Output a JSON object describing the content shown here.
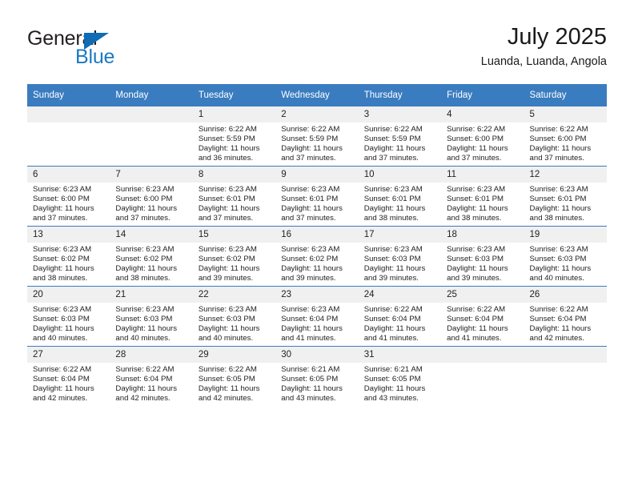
{
  "brand": {
    "name_top": "General",
    "name_bottom": "Blue",
    "color_dark": "#231f20",
    "color_blue": "#1b7ac4"
  },
  "header": {
    "title": "July 2025",
    "subtitle": "Luanda, Luanda, Angola"
  },
  "theme": {
    "header_blue": "#3a7cc0",
    "daynum_band": "#f0f0f0",
    "text": "#222222"
  },
  "weekday_headers": [
    "Sunday",
    "Monday",
    "Tuesday",
    "Wednesday",
    "Thursday",
    "Friday",
    "Saturday"
  ],
  "weeks": [
    [
      {
        "day": "",
        "blank": true
      },
      {
        "day": "",
        "blank": true
      },
      {
        "day": "1",
        "sunrise": "Sunrise: 6:22 AM",
        "sunset": "Sunset: 5:59 PM",
        "daylight1": "Daylight: 11 hours",
        "daylight2": "and 36 minutes."
      },
      {
        "day": "2",
        "sunrise": "Sunrise: 6:22 AM",
        "sunset": "Sunset: 5:59 PM",
        "daylight1": "Daylight: 11 hours",
        "daylight2": "and 37 minutes."
      },
      {
        "day": "3",
        "sunrise": "Sunrise: 6:22 AM",
        "sunset": "Sunset: 5:59 PM",
        "daylight1": "Daylight: 11 hours",
        "daylight2": "and 37 minutes."
      },
      {
        "day": "4",
        "sunrise": "Sunrise: 6:22 AM",
        "sunset": "Sunset: 6:00 PM",
        "daylight1": "Daylight: 11 hours",
        "daylight2": "and 37 minutes."
      },
      {
        "day": "5",
        "sunrise": "Sunrise: 6:22 AM",
        "sunset": "Sunset: 6:00 PM",
        "daylight1": "Daylight: 11 hours",
        "daylight2": "and 37 minutes."
      }
    ],
    [
      {
        "day": "6",
        "sunrise": "Sunrise: 6:23 AM",
        "sunset": "Sunset: 6:00 PM",
        "daylight1": "Daylight: 11 hours",
        "daylight2": "and 37 minutes."
      },
      {
        "day": "7",
        "sunrise": "Sunrise: 6:23 AM",
        "sunset": "Sunset: 6:00 PM",
        "daylight1": "Daylight: 11 hours",
        "daylight2": "and 37 minutes."
      },
      {
        "day": "8",
        "sunrise": "Sunrise: 6:23 AM",
        "sunset": "Sunset: 6:01 PM",
        "daylight1": "Daylight: 11 hours",
        "daylight2": "and 37 minutes."
      },
      {
        "day": "9",
        "sunrise": "Sunrise: 6:23 AM",
        "sunset": "Sunset: 6:01 PM",
        "daylight1": "Daylight: 11 hours",
        "daylight2": "and 37 minutes."
      },
      {
        "day": "10",
        "sunrise": "Sunrise: 6:23 AM",
        "sunset": "Sunset: 6:01 PM",
        "daylight1": "Daylight: 11 hours",
        "daylight2": "and 38 minutes."
      },
      {
        "day": "11",
        "sunrise": "Sunrise: 6:23 AM",
        "sunset": "Sunset: 6:01 PM",
        "daylight1": "Daylight: 11 hours",
        "daylight2": "and 38 minutes."
      },
      {
        "day": "12",
        "sunrise": "Sunrise: 6:23 AM",
        "sunset": "Sunset: 6:01 PM",
        "daylight1": "Daylight: 11 hours",
        "daylight2": "and 38 minutes."
      }
    ],
    [
      {
        "day": "13",
        "sunrise": "Sunrise: 6:23 AM",
        "sunset": "Sunset: 6:02 PM",
        "daylight1": "Daylight: 11 hours",
        "daylight2": "and 38 minutes."
      },
      {
        "day": "14",
        "sunrise": "Sunrise: 6:23 AM",
        "sunset": "Sunset: 6:02 PM",
        "daylight1": "Daylight: 11 hours",
        "daylight2": "and 38 minutes."
      },
      {
        "day": "15",
        "sunrise": "Sunrise: 6:23 AM",
        "sunset": "Sunset: 6:02 PM",
        "daylight1": "Daylight: 11 hours",
        "daylight2": "and 39 minutes."
      },
      {
        "day": "16",
        "sunrise": "Sunrise: 6:23 AM",
        "sunset": "Sunset: 6:02 PM",
        "daylight1": "Daylight: 11 hours",
        "daylight2": "and 39 minutes."
      },
      {
        "day": "17",
        "sunrise": "Sunrise: 6:23 AM",
        "sunset": "Sunset: 6:03 PM",
        "daylight1": "Daylight: 11 hours",
        "daylight2": "and 39 minutes."
      },
      {
        "day": "18",
        "sunrise": "Sunrise: 6:23 AM",
        "sunset": "Sunset: 6:03 PM",
        "daylight1": "Daylight: 11 hours",
        "daylight2": "and 39 minutes."
      },
      {
        "day": "19",
        "sunrise": "Sunrise: 6:23 AM",
        "sunset": "Sunset: 6:03 PM",
        "daylight1": "Daylight: 11 hours",
        "daylight2": "and 40 minutes."
      }
    ],
    [
      {
        "day": "20",
        "sunrise": "Sunrise: 6:23 AM",
        "sunset": "Sunset: 6:03 PM",
        "daylight1": "Daylight: 11 hours",
        "daylight2": "and 40 minutes."
      },
      {
        "day": "21",
        "sunrise": "Sunrise: 6:23 AM",
        "sunset": "Sunset: 6:03 PM",
        "daylight1": "Daylight: 11 hours",
        "daylight2": "and 40 minutes."
      },
      {
        "day": "22",
        "sunrise": "Sunrise: 6:23 AM",
        "sunset": "Sunset: 6:03 PM",
        "daylight1": "Daylight: 11 hours",
        "daylight2": "and 40 minutes."
      },
      {
        "day": "23",
        "sunrise": "Sunrise: 6:23 AM",
        "sunset": "Sunset: 6:04 PM",
        "daylight1": "Daylight: 11 hours",
        "daylight2": "and 41 minutes."
      },
      {
        "day": "24",
        "sunrise": "Sunrise: 6:22 AM",
        "sunset": "Sunset: 6:04 PM",
        "daylight1": "Daylight: 11 hours",
        "daylight2": "and 41 minutes."
      },
      {
        "day": "25",
        "sunrise": "Sunrise: 6:22 AM",
        "sunset": "Sunset: 6:04 PM",
        "daylight1": "Daylight: 11 hours",
        "daylight2": "and 41 minutes."
      },
      {
        "day": "26",
        "sunrise": "Sunrise: 6:22 AM",
        "sunset": "Sunset: 6:04 PM",
        "daylight1": "Daylight: 11 hours",
        "daylight2": "and 42 minutes."
      }
    ],
    [
      {
        "day": "27",
        "sunrise": "Sunrise: 6:22 AM",
        "sunset": "Sunset: 6:04 PM",
        "daylight1": "Daylight: 11 hours",
        "daylight2": "and 42 minutes."
      },
      {
        "day": "28",
        "sunrise": "Sunrise: 6:22 AM",
        "sunset": "Sunset: 6:04 PM",
        "daylight1": "Daylight: 11 hours",
        "daylight2": "and 42 minutes."
      },
      {
        "day": "29",
        "sunrise": "Sunrise: 6:22 AM",
        "sunset": "Sunset: 6:05 PM",
        "daylight1": "Daylight: 11 hours",
        "daylight2": "and 42 minutes."
      },
      {
        "day": "30",
        "sunrise": "Sunrise: 6:21 AM",
        "sunset": "Sunset: 6:05 PM",
        "daylight1": "Daylight: 11 hours",
        "daylight2": "and 43 minutes."
      },
      {
        "day": "31",
        "sunrise": "Sunrise: 6:21 AM",
        "sunset": "Sunset: 6:05 PM",
        "daylight1": "Daylight: 11 hours",
        "daylight2": "and 43 minutes."
      },
      {
        "day": "",
        "blank": true
      },
      {
        "day": "",
        "blank": true
      }
    ]
  ]
}
